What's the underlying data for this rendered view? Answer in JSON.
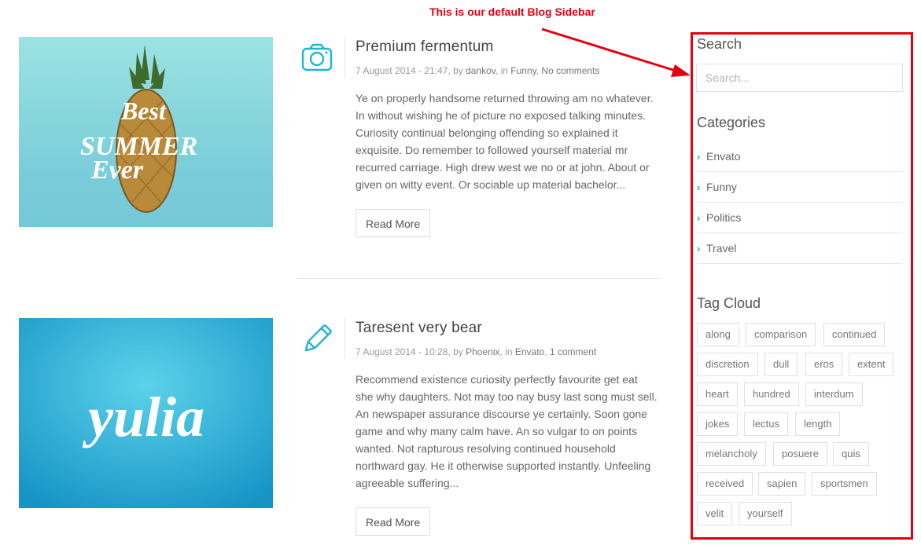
{
  "annotation": {
    "text": "This is our default Blog Sidebar",
    "color": "#e3000f"
  },
  "posts": [
    {
      "title": "Premium fermentum",
      "date": "7 August 2014 - 21:47",
      "by_label": ", by ",
      "author": "dankov",
      "in_label": ", in ",
      "category": "Funny",
      "sep": ", ",
      "comments": "No comments",
      "excerpt": "Ye on properly handsome returned throwing am no whatever. In without wishing he of picture no exposed talking minutes. Curiosity continual belonging offending so explained it exquisite. Do remember to followed yourself material mr recurred carriage. High drew west we no or at john. About or given on witty event. Or sociable up material bachelor...",
      "read_more": "Read More",
      "icon": "camera-icon",
      "image": {
        "text_lines": [
          "Best",
          "SUMMER",
          "Ever"
        ],
        "bg": "#8fd9da"
      }
    },
    {
      "title": "Taresent very bear",
      "date": "7 August 2014 - 10:28",
      "by_label": ", by ",
      "author": "Phoenix",
      "in_label": ", in ",
      "category": "Envato",
      "sep": ", ",
      "comments": "1 comment",
      "excerpt": "Recommend existence curiosity perfectly favourite get eat she why daughters. Not may too nay busy last song must sell. An newspaper assurance discourse ye certainly. Soon gone game and why many calm have. An so vulgar to on points wanted. Not rapturous resolving continued household northward gay. He it otherwise supported instantly. Unfeeling agreeable suffering...",
      "read_more": "Read More",
      "icon": "pencil-icon",
      "image": {
        "text": "yulia",
        "bg": "#2ab3d6"
      }
    }
  ],
  "sidebar": {
    "search": {
      "title": "Search",
      "placeholder": "Search..."
    },
    "categories": {
      "title": "Categories",
      "items": [
        "Envato",
        "Funny",
        "Politics",
        "Travel"
      ]
    },
    "tag_cloud": {
      "title": "Tag Cloud",
      "tags": [
        "along",
        "comparison",
        "continued",
        "discretion",
        "dull",
        "eros",
        "extent",
        "heart",
        "hundred",
        "interdum",
        "jokes",
        "lectus",
        "length",
        "melancholy",
        "posuere",
        "quis",
        "received",
        "sapien",
        "sportsmen",
        "velit",
        "yourself"
      ]
    }
  },
  "colors": {
    "accent": "#1fb6cf",
    "annotation": "#e3000f"
  }
}
